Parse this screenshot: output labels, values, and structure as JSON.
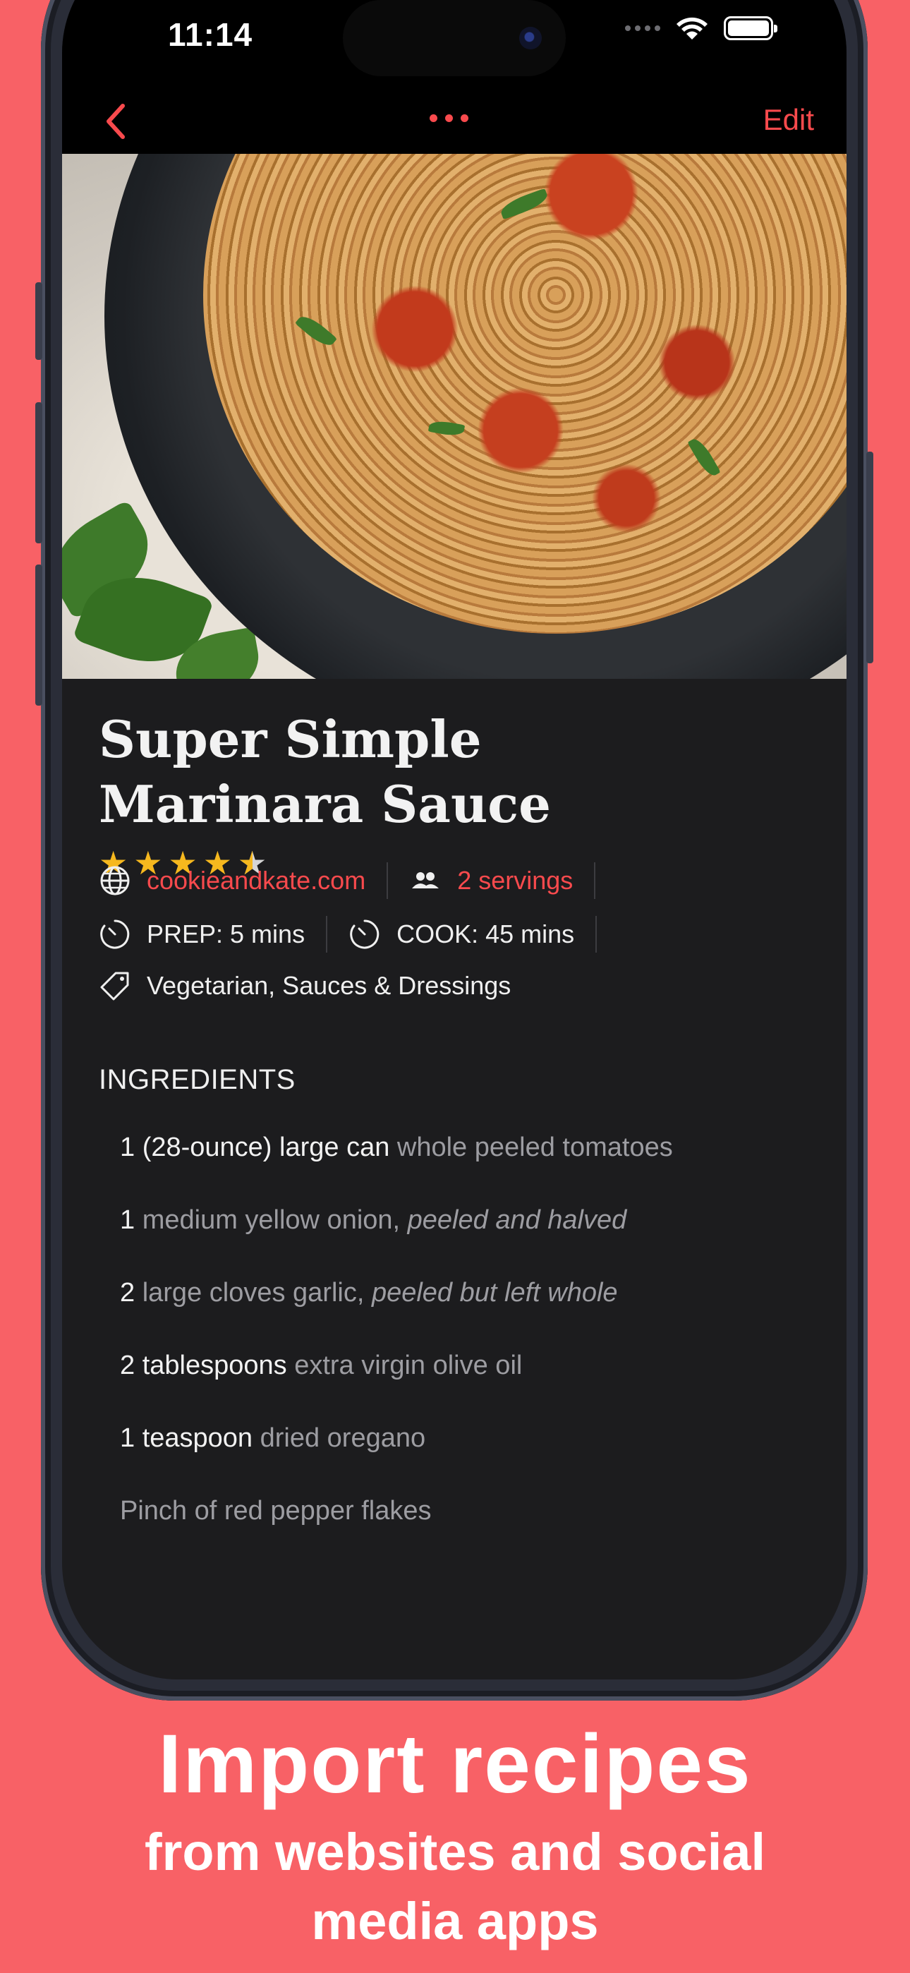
{
  "status_bar": {
    "time": "11:14"
  },
  "nav": {
    "edit_label": "Edit",
    "back_icon": "chevron-left-icon",
    "more_icon": "ellipsis-icon"
  },
  "recipe": {
    "title_line1": "Super Simple",
    "title_line2": "Marinara Sauce",
    "rating": 4.5,
    "source": "cookieandkate.com",
    "servings": "2 servings",
    "prep": "PREP: 5 mins",
    "cook": "COOK: 45 mins",
    "tags": "Vegetarian, Sauces & Dressings"
  },
  "ingredients": {
    "header": "INGREDIENTS",
    "items": [
      {
        "qty": "1 (28-ounce) large can",
        "name": " whole peeled tomatoes",
        "note": ""
      },
      {
        "qty": "1",
        "name": " medium yellow onion, ",
        "note": "peeled and halved"
      },
      {
        "qty": "2",
        "name": " large cloves garlic, ",
        "note": "peeled but left whole"
      },
      {
        "qty": "2 tablespoons",
        "name": " extra virgin olive oil",
        "note": ""
      },
      {
        "qty": "1 teaspoon",
        "name": " dried oregano",
        "note": ""
      },
      {
        "qty": "",
        "name": "Pinch of red pepper flakes",
        "note": ""
      }
    ]
  },
  "caption": {
    "line1": "Import recipes",
    "line2": "from websites and social",
    "line3": "media apps"
  },
  "colors": {
    "accent": "#f84a4d",
    "background": "#f86166",
    "star": "#f6b81e",
    "screen": "#1c1c1e"
  }
}
